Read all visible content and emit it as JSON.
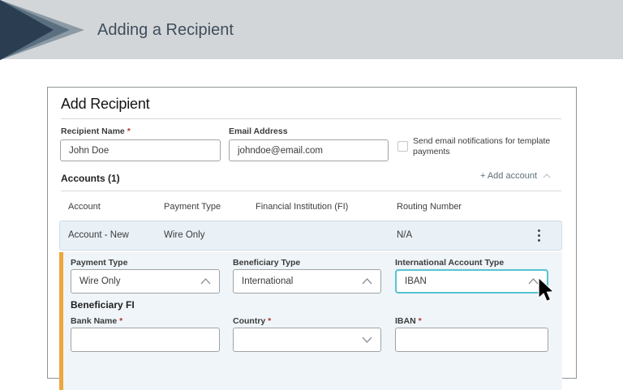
{
  "banner": {
    "title": "Adding a Recipient"
  },
  "form": {
    "title": "Add Recipient",
    "recipient_name": {
      "label": "Recipient Name",
      "value": "John Doe"
    },
    "email": {
      "label": "Email Address",
      "value": "johndoe@email.com"
    },
    "notify_checkbox": {
      "label": "Send email notifications for template payments",
      "checked": false
    }
  },
  "accounts": {
    "heading": "Accounts (1)",
    "add_account_label": "+ Add account",
    "table": {
      "headers": [
        "Account",
        "Payment Type",
        "Financial Institution (FI)",
        "Routing Number"
      ],
      "rows": [
        {
          "account": "Account - New",
          "payment_type": "Wire Only",
          "fi": "",
          "routing": "N/A"
        }
      ]
    },
    "detail": {
      "payment_type": {
        "label": "Payment Type",
        "value": "Wire Only"
      },
      "beneficiary_type": {
        "label": "Beneficiary Type",
        "value": "International"
      },
      "intl_account_type": {
        "label": "International Account Type",
        "value": "IBAN"
      },
      "beneficiary_fi_heading": "Beneficiary FI",
      "bank_name": {
        "label": "Bank Name",
        "value": ""
      },
      "country": {
        "label": "Country",
        "value": ""
      },
      "iban": {
        "label": "IBAN",
        "value": ""
      }
    }
  },
  "misc": {
    "required_marker": "*"
  },
  "colors": {
    "accent_teal": "#57c3d2",
    "accent_yellow": "#eda73c",
    "banner_bg": "#d3d6d8",
    "row_bg": "#e9f1f7"
  }
}
